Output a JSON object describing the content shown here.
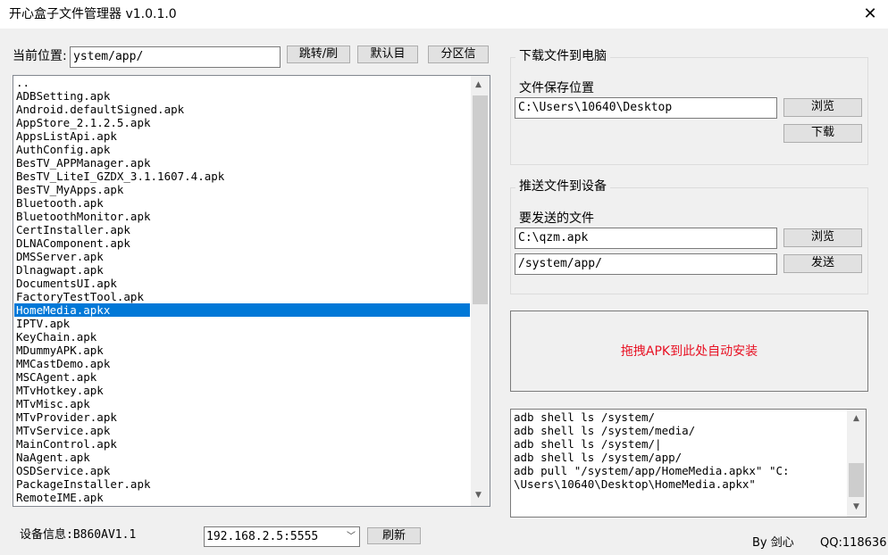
{
  "window": {
    "title": "开心盒子文件管理器 v1.0.1.0",
    "close_glyph": "✕"
  },
  "location": {
    "label": "当前位置:",
    "path_value": "ystem/app/",
    "jump_button": "跳转/刷",
    "default_button": "默认目",
    "partition_button": "分区信"
  },
  "file_list": {
    "items": [
      "..",
      "ADBSetting.apk",
      "Android.defaultSigned.apk",
      "AppStore_2.1.2.5.apk",
      "AppsListApi.apk",
      "AuthConfig.apk",
      "BesTV_APPManager.apk",
      "BesTV_LiteI_GZDX_3.1.1607.4.apk",
      "BesTV_MyApps.apk",
      "Bluetooth.apk",
      "BluetoothMonitor.apk",
      "CertInstaller.apk",
      "DLNAComponent.apk",
      "DMSServer.apk",
      "Dlnagwapt.apk",
      "DocumentsUI.apk",
      "FactoryTestTool.apk",
      "HomeMedia.apkx",
      "IPTV.apk",
      "KeyChain.apk",
      "MDummyAPK.apk",
      "MMCastDemo.apk",
      "MSCAgent.apk",
      "MTvHotkey.apk",
      "MTvMisc.apk",
      "MTvProvider.apk",
      "MTvService.apk",
      "MainControl.apk",
      "NaAgent.apk",
      "OSDService.apk",
      "PackageInstaller.apk",
      "RemoteIME.apk"
    ],
    "selected_index": 17
  },
  "download": {
    "group_title": "下载文件到电脑",
    "save_location_label": "文件保存位置",
    "save_path_value": "C:\\Users\\10640\\Desktop",
    "browse_button": "浏览",
    "download_button": "下载"
  },
  "push": {
    "group_title": "推送文件到设备",
    "file_label": "要发送的文件",
    "file_value": "C:\\qzm.apk",
    "target_value": "/system/app/",
    "browse_button": "浏览",
    "send_button": "发送"
  },
  "drop_zone": {
    "text": "拖拽APK到此处自动安装",
    "text_color": "#e81123"
  },
  "log": {
    "lines": [
      "adb shell ls /system/",
      "adb shell ls /system/media/",
      "adb shell ls /system/|",
      "adb shell ls /system/app/",
      "adb pull \"/system/app/HomeMedia.apkx\" \"C:",
      "\\Users\\10640\\Desktop\\HomeMedia.apkx\""
    ]
  },
  "device": {
    "info_label": "设备信息:B860AV1.1",
    "address_value": "192.168.2.5:5555",
    "refresh_button": "刷新"
  },
  "footer": {
    "author": "By 剑心",
    "qq": "QQ:118636"
  },
  "colors": {
    "selection": "#0078d7",
    "window_bg": "#f0f0f0"
  },
  "icons": {
    "scroll_up": "▲",
    "scroll_down": "▼",
    "combo_arrow": "﹀"
  }
}
